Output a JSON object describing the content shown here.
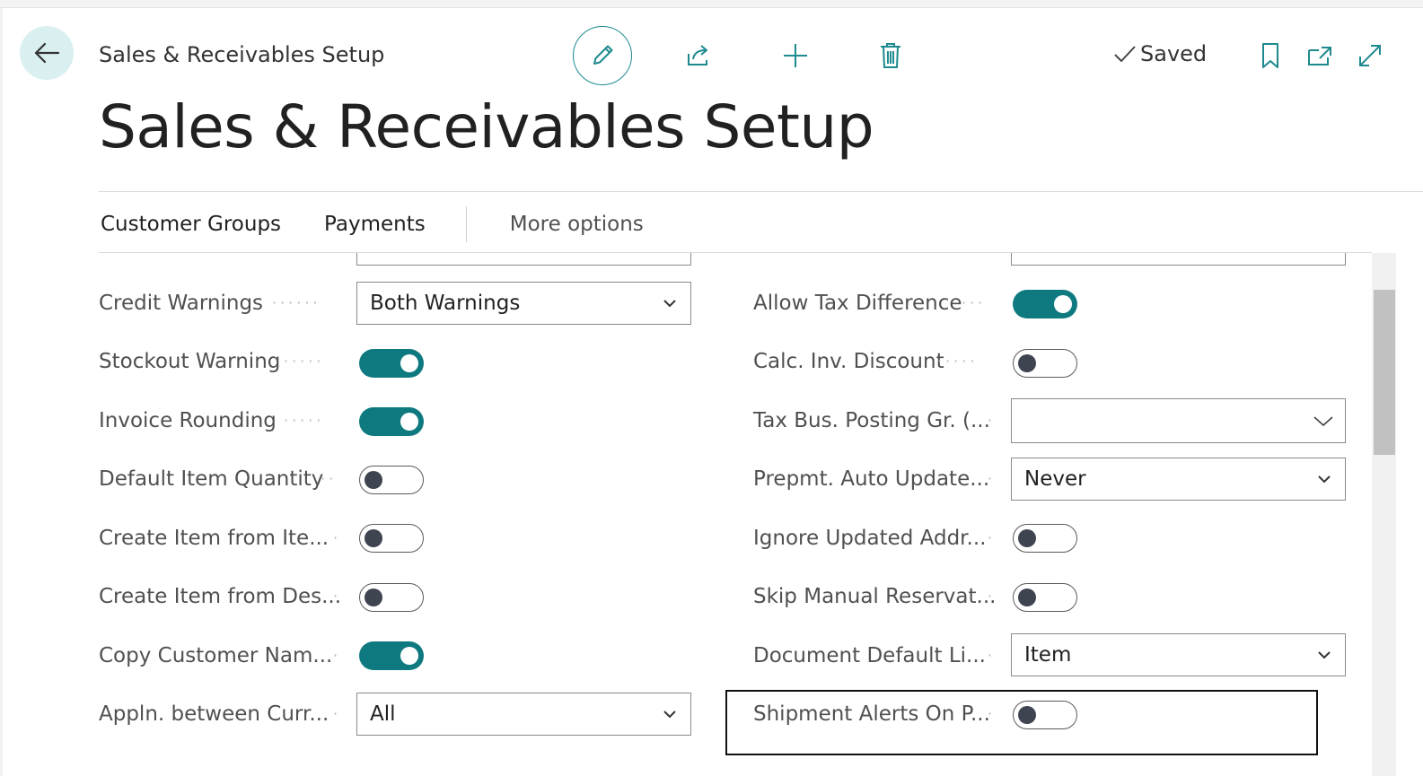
{
  "breadcrumb": "Sales & Receivables Setup",
  "title": "Sales & Receivables Setup",
  "status": {
    "saved": "Saved"
  },
  "actions": [
    {
      "label": "Customer Groups"
    },
    {
      "label": "Payments"
    },
    {
      "label": "More options"
    }
  ],
  "left_fields": [
    {
      "label": "Credit Warnings",
      "type": "select",
      "value": "Both Warnings"
    },
    {
      "label": "Stockout Warning",
      "type": "toggle",
      "value": true
    },
    {
      "label": "Invoice Rounding",
      "type": "toggle",
      "value": true
    },
    {
      "label": "Default Item Quantity",
      "type": "toggle",
      "value": false
    },
    {
      "label": "Create Item from Ite...",
      "type": "toggle",
      "value": false
    },
    {
      "label": "Create Item from Des...",
      "type": "toggle",
      "value": false
    },
    {
      "label": "Copy Customer Nam...",
      "type": "toggle",
      "value": true
    },
    {
      "label": "Appln. between Curr...",
      "type": "select",
      "value": "All"
    }
  ],
  "right_fields": [
    {
      "label": "Allow Tax Difference",
      "type": "toggle",
      "value": true
    },
    {
      "label": "Calc. Inv. Discount",
      "type": "toggle",
      "value": false
    },
    {
      "label": "Tax Bus. Posting Gr. (...",
      "type": "select",
      "value": ""
    },
    {
      "label": "Prepmt. Auto Update...",
      "type": "select",
      "value": "Never"
    },
    {
      "label": "Ignore Updated Addr...",
      "type": "toggle",
      "value": false
    },
    {
      "label": "Skip Manual Reservat...",
      "type": "toggle",
      "value": false
    },
    {
      "label": "Document Default Li...",
      "type": "select",
      "value": "Item"
    },
    {
      "label": "Shipment Alerts On P...",
      "type": "toggle",
      "value": false
    }
  ],
  "colors": {
    "accent": "#0e7a80",
    "back_bg": "#d9eff0"
  }
}
